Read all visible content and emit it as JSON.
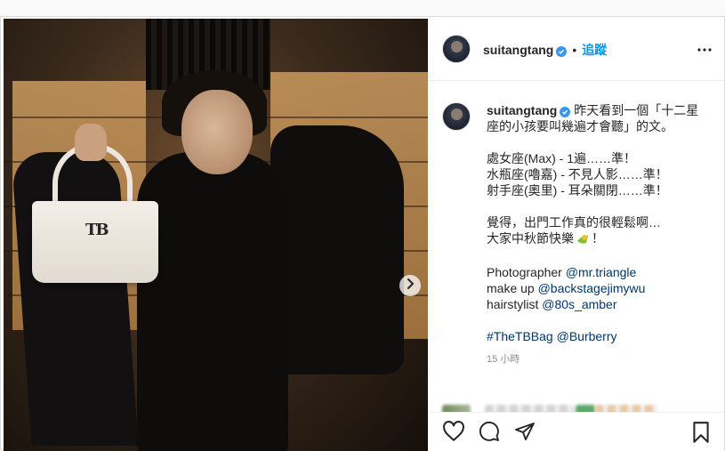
{
  "post": {
    "username": "suitangtang",
    "follow_label": "追蹤",
    "separator": "•",
    "caption": {
      "line1": "昨天看到一個「十二星",
      "line2": "座的小孩要叫幾遍才會聽」的文。",
      "sign1": "處女座(Max) - 1遍……準！",
      "sign2": "水瓶座(嚕嘉) - 不見人影……準！",
      "sign3": "射手座(奧里) - 耳朵關閉……準！",
      "feel1": "覺得，出門工作真的很輕鬆啊…",
      "feel2_text": "大家中秋節快樂",
      "feel2_end": "！",
      "credit1_label": "Photographer",
      "credit1_handle": "@mr.triangle",
      "credit2_label": "make up",
      "credit2_handle": "@backstagejimywu",
      "credit3_label": "hairstylist",
      "credit3_handle": "@80s_amber",
      "hashtag": "#TheTBBag",
      "mention": "@Burberry"
    },
    "time_ago": "15 小時",
    "bag_logo": "TB"
  },
  "icons": {
    "verified": "verified-badge-icon",
    "more": "more-options-icon",
    "next": "chevron-right-icon",
    "like": "heart-icon",
    "comment": "comment-icon",
    "share": "paper-plane-icon",
    "save": "bookmark-icon",
    "comment_like": "small-heart-icon"
  },
  "colors": {
    "accent": "#0095f6",
    "verified": "#3897f0",
    "link": "#00376b",
    "muted": "#8e8e8e"
  }
}
